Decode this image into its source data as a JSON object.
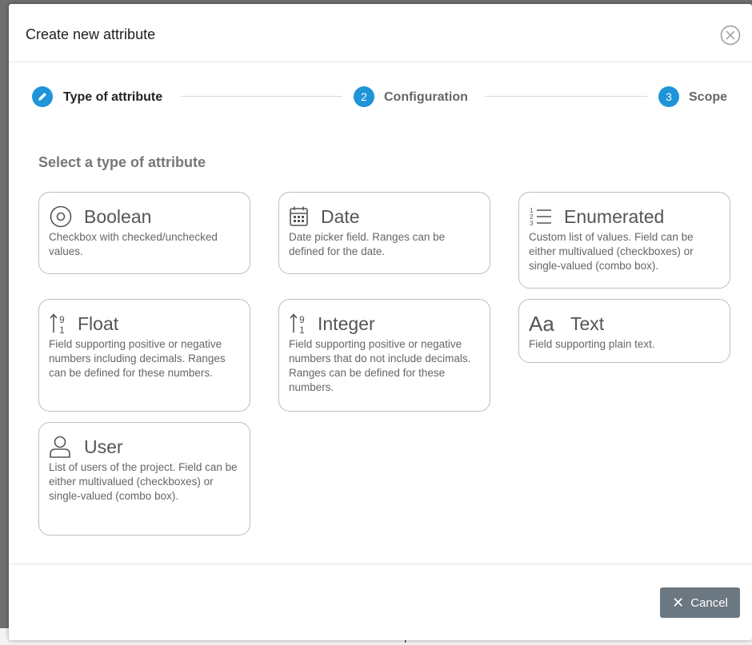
{
  "dialog": {
    "title": "Create new attribute",
    "close_icon": "close-circle-icon"
  },
  "stepper": {
    "steps": [
      {
        "number": "",
        "label": "Type of attribute",
        "icon": "pencil-icon",
        "state": "current"
      },
      {
        "number": "2",
        "label": "Configuration",
        "state": "pending"
      },
      {
        "number": "3",
        "label": "Scope",
        "state": "pending"
      }
    ]
  },
  "section_title": "Select a type of attribute",
  "types": [
    {
      "name": "Boolean",
      "icon": "radio-target-icon",
      "description": "Checkbox with checked/unchecked values."
    },
    {
      "name": "Date",
      "icon": "calendar-icon",
      "description": "Date picker field. Ranges can be defined for the date."
    },
    {
      "name": "Enumerated",
      "icon": "numbered-list-icon",
      "description": "Custom list of values. Field can be either multivalued (checkboxes) or single-valued (combo box)."
    },
    {
      "name": "Float",
      "icon": "sort-numeric-icon",
      "description": "Field supporting positive or negative numbers including decimals. Ranges can be defined for these numbers."
    },
    {
      "name": "Integer",
      "icon": "sort-numeric-icon",
      "description": "Field supporting positive or negative numbers that do not include decimals. Ranges can be defined for these numbers."
    },
    {
      "name": "Text",
      "icon": "text-font-icon",
      "description": "Field supporting plain text."
    },
    {
      "name": "User",
      "icon": "user-icon",
      "description": "List of users of the project. Field can be either multivalued (checkboxes) or single-valued (combo box)."
    }
  ],
  "footer": {
    "cancel_label": "Cancel"
  },
  "colors": {
    "accent": "#1f94d9",
    "cancel_button": "#6b7781",
    "card_border": "#bdbdbd"
  }
}
